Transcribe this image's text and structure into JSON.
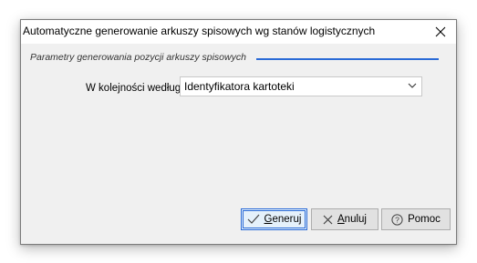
{
  "window": {
    "title": "Automatyczne generowanie arkuszy spisowych wg stanów logistycznych"
  },
  "group": {
    "legend": "Parametry generowania pozycji arkuszy spisowych"
  },
  "order": {
    "label": "W kolejności według",
    "selected": "Identyfikatora kartoteki"
  },
  "buttons": {
    "generate": "Generuj",
    "cancel": "Anuluj",
    "help": "Pomoc"
  },
  "colors": {
    "accent": "#2a6ad6",
    "window_bg": "#f0f0f0",
    "button_bg": "#e1e1e1"
  },
  "icons": {
    "close": "close-icon",
    "dropdown": "chevron-down-icon",
    "generate": "checkmark-icon",
    "cancel": "x-icon",
    "help": "question-circle-icon"
  }
}
